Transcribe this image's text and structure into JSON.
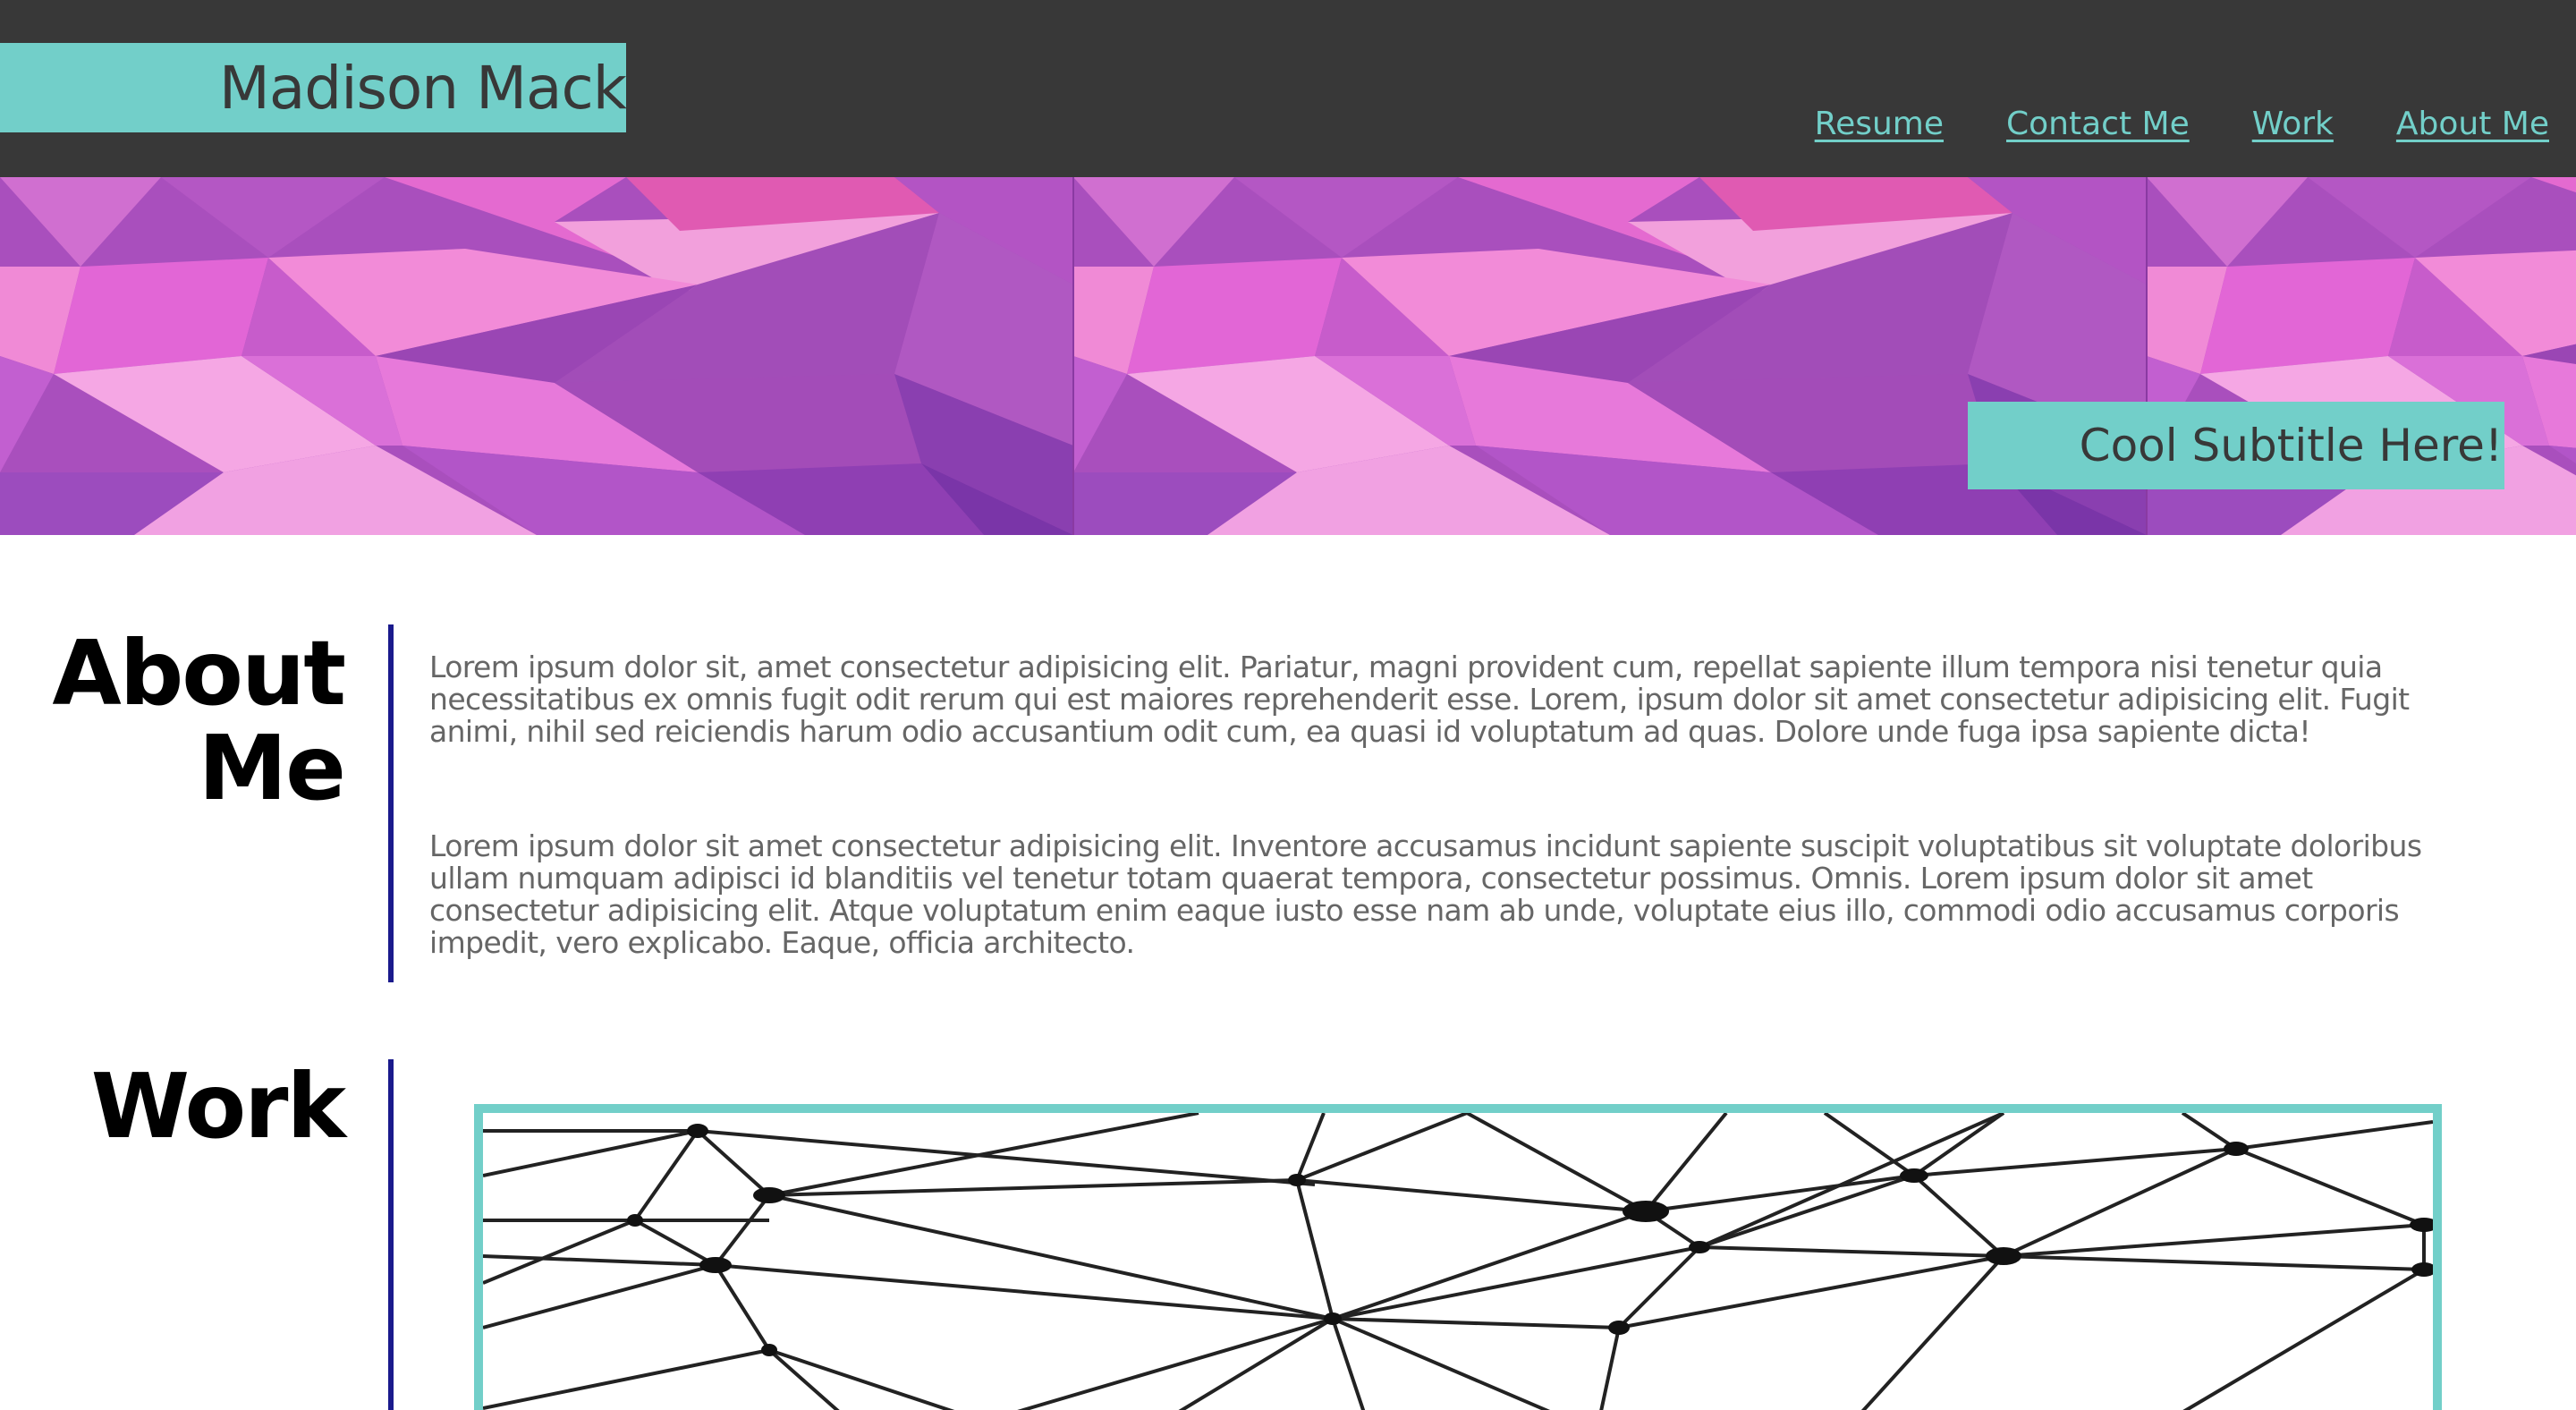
{
  "header": {
    "brand": "Madison Mack",
    "nav": [
      "Resume",
      "Contact Me",
      "Work",
      "About Me"
    ]
  },
  "hero": {
    "subtitle": "Cool Subtitle Here!"
  },
  "about": {
    "title_line1": "About",
    "title_line2": "Me",
    "paragraph1": "Lorem ipsum dolor sit, amet consectetur adipisicing elit. Pariatur, magni provident cum, repellat sapiente illum tempora nisi tenetur quia necessitatibus ex omnis fugit odit rerum qui est maiores reprehenderit esse. Lorem, ipsum dolor sit amet consectetur adipisicing elit. Fugit animi, nihil sed reiciendis harum odio accusantium odit cum, ea quasi id voluptatum ad quas. Dolore unde fuga ipsa sapiente dicta!",
    "paragraph2": "Lorem ipsum dolor sit amet consectetur adipisicing elit. Inventore accusamus incidunt sapiente suscipit voluptatibus sit voluptate doloribus ullam numquam adipisci id blanditiis vel tenetur totam quaerat tempora, consectetur possimus. Omnis. Lorem ipsum dolor sit amet consectetur adipisicing elit. Atque voluptatum enim eaque iusto esse nam ab unde, voluptate eius illo, commodi odio accusamus corporis impedit, vero explicabo. Eaque, officia architecto."
  },
  "work": {
    "title": "Work"
  },
  "colors": {
    "header_bg": "#383838",
    "accent": "#72cfc9",
    "divider": "#1a1a8c",
    "hero_purple": "#a14db5",
    "hero_pink": "#f06fd4"
  }
}
